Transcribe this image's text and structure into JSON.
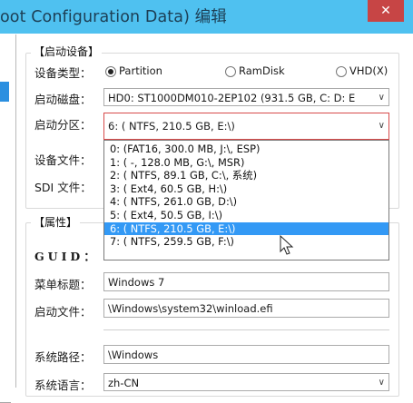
{
  "title": "oot Configuration Data) 编辑",
  "close_label": "✕",
  "boot_device": {
    "legend": "【启动设备】",
    "device_type_label": "设备类型：",
    "device_type_options": [
      "Partition",
      "RamDisk",
      "VHD(X)"
    ],
    "device_type_selected": "Partition",
    "disk_label": "启动磁盘：",
    "disk_value": "HD0: ST1000DM010-2EP102 (931.5 GB, C: D: E",
    "partition_label": "启动分区：",
    "partition_value": "6: ( NTFS, 210.5 GB, E:\\)",
    "device_file_label": "设备文件：",
    "sdi_file_label": "SDI 文件："
  },
  "partition_dropdown": {
    "items": [
      "0: (FAT16, 300.0 MB, J:\\, ESP)",
      "1: (   -, 128.0 MB, G:\\, MSR)",
      "2: ( NTFS,  89.1 GB, C:\\, 系统)",
      "3: ( Ext4,  60.5 GB, H:\\)",
      "4: ( NTFS, 261.0 GB, D:\\)",
      "5: ( Ext4,  50.5 GB, I:\\)",
      "6: ( NTFS, 210.5 GB, E:\\)",
      "7: ( NTFS, 259.5 GB, F:\\)"
    ],
    "selected_index": 6
  },
  "properties": {
    "legend": "【属性】",
    "guid_label": "GUID：",
    "menu_title_label": "菜单标题：",
    "menu_title_value": "Windows 7",
    "boot_file_label": "启动文件：",
    "boot_file_value": "\\Windows\\system32\\winload.efi",
    "system_path_label": "系统路径：",
    "system_path_value": "\\Windows",
    "system_lang_label": "系统语言：",
    "system_lang_value": "zh-CN"
  },
  "colors": {
    "titlebar": "#4fc1f0",
    "close": "#c74545",
    "selection": "#3399f5",
    "focus_border": "#d74b4b"
  }
}
